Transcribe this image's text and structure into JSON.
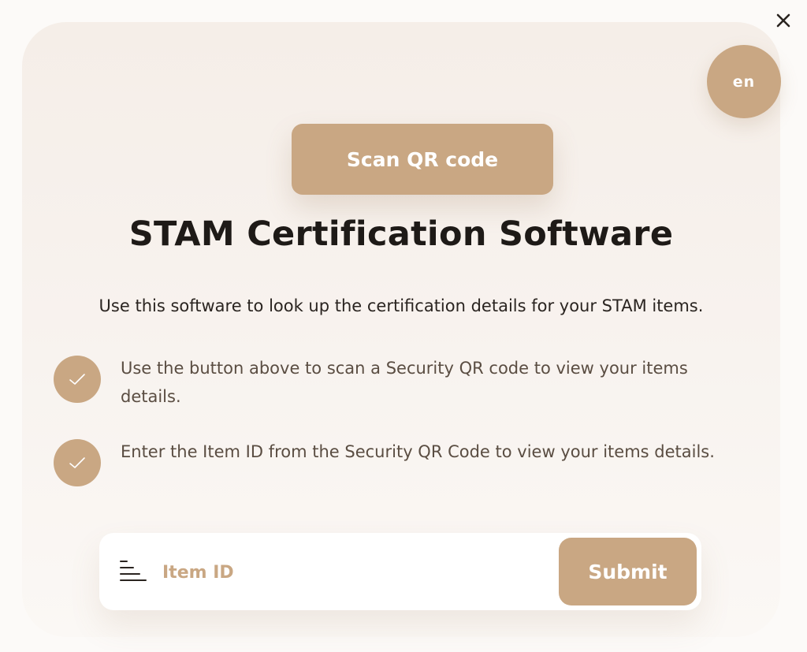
{
  "header": {
    "close_icon": "close-icon",
    "language_label": "en"
  },
  "main": {
    "scan_button_label": "Scan QR code",
    "title": "STAM Certification Software",
    "intro": "Use this software to look up the certification details for your STAM items.",
    "steps": [
      {
        "icon": "check-icon",
        "text": "Use the button above to scan a Security QR code to view your items details."
      },
      {
        "icon": "check-icon",
        "text": "Enter the Item ID from the Security QR Code to view your items details."
      }
    ]
  },
  "form": {
    "input_icon": "list-icon",
    "item_id_placeholder": "Item ID",
    "item_id_value": "",
    "submit_label": "Submit"
  },
  "colors": {
    "accent": "#c9a783",
    "title_text": "#1e1a17",
    "body_text": "#5a4d42",
    "background": "#f5eee8"
  }
}
